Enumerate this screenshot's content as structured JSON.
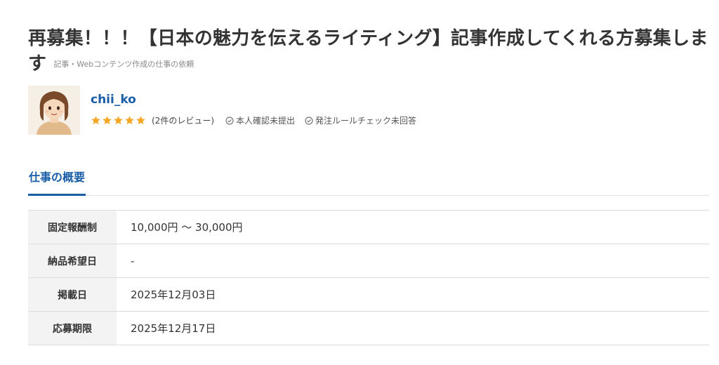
{
  "job": {
    "title": "再募集！！！【日本の魅力を伝えるライティング】記事作成してくれる方募集します",
    "category": "記事・Webコンテンツ作成の仕事の依頼"
  },
  "client": {
    "username": "chii_ko",
    "rating": 5,
    "reviews": "(2件のレビュー)",
    "identity_status": "本人確認未提出",
    "rule_check_status": "発注ルールチェック未回答",
    "star_color": "#f5a623",
    "link_color": "#1a5ea8"
  },
  "tabs": [
    {
      "label": "仕事の概要",
      "active": true
    }
  ],
  "overview": [
    {
      "label": "固定報酬制",
      "value": "10,000円 〜 30,000円"
    },
    {
      "label": "納品希望日",
      "value": "-"
    },
    {
      "label": "掲載日",
      "value": "2025年12月03日"
    },
    {
      "label": "応募期限",
      "value": "2025年12月17日"
    }
  ]
}
